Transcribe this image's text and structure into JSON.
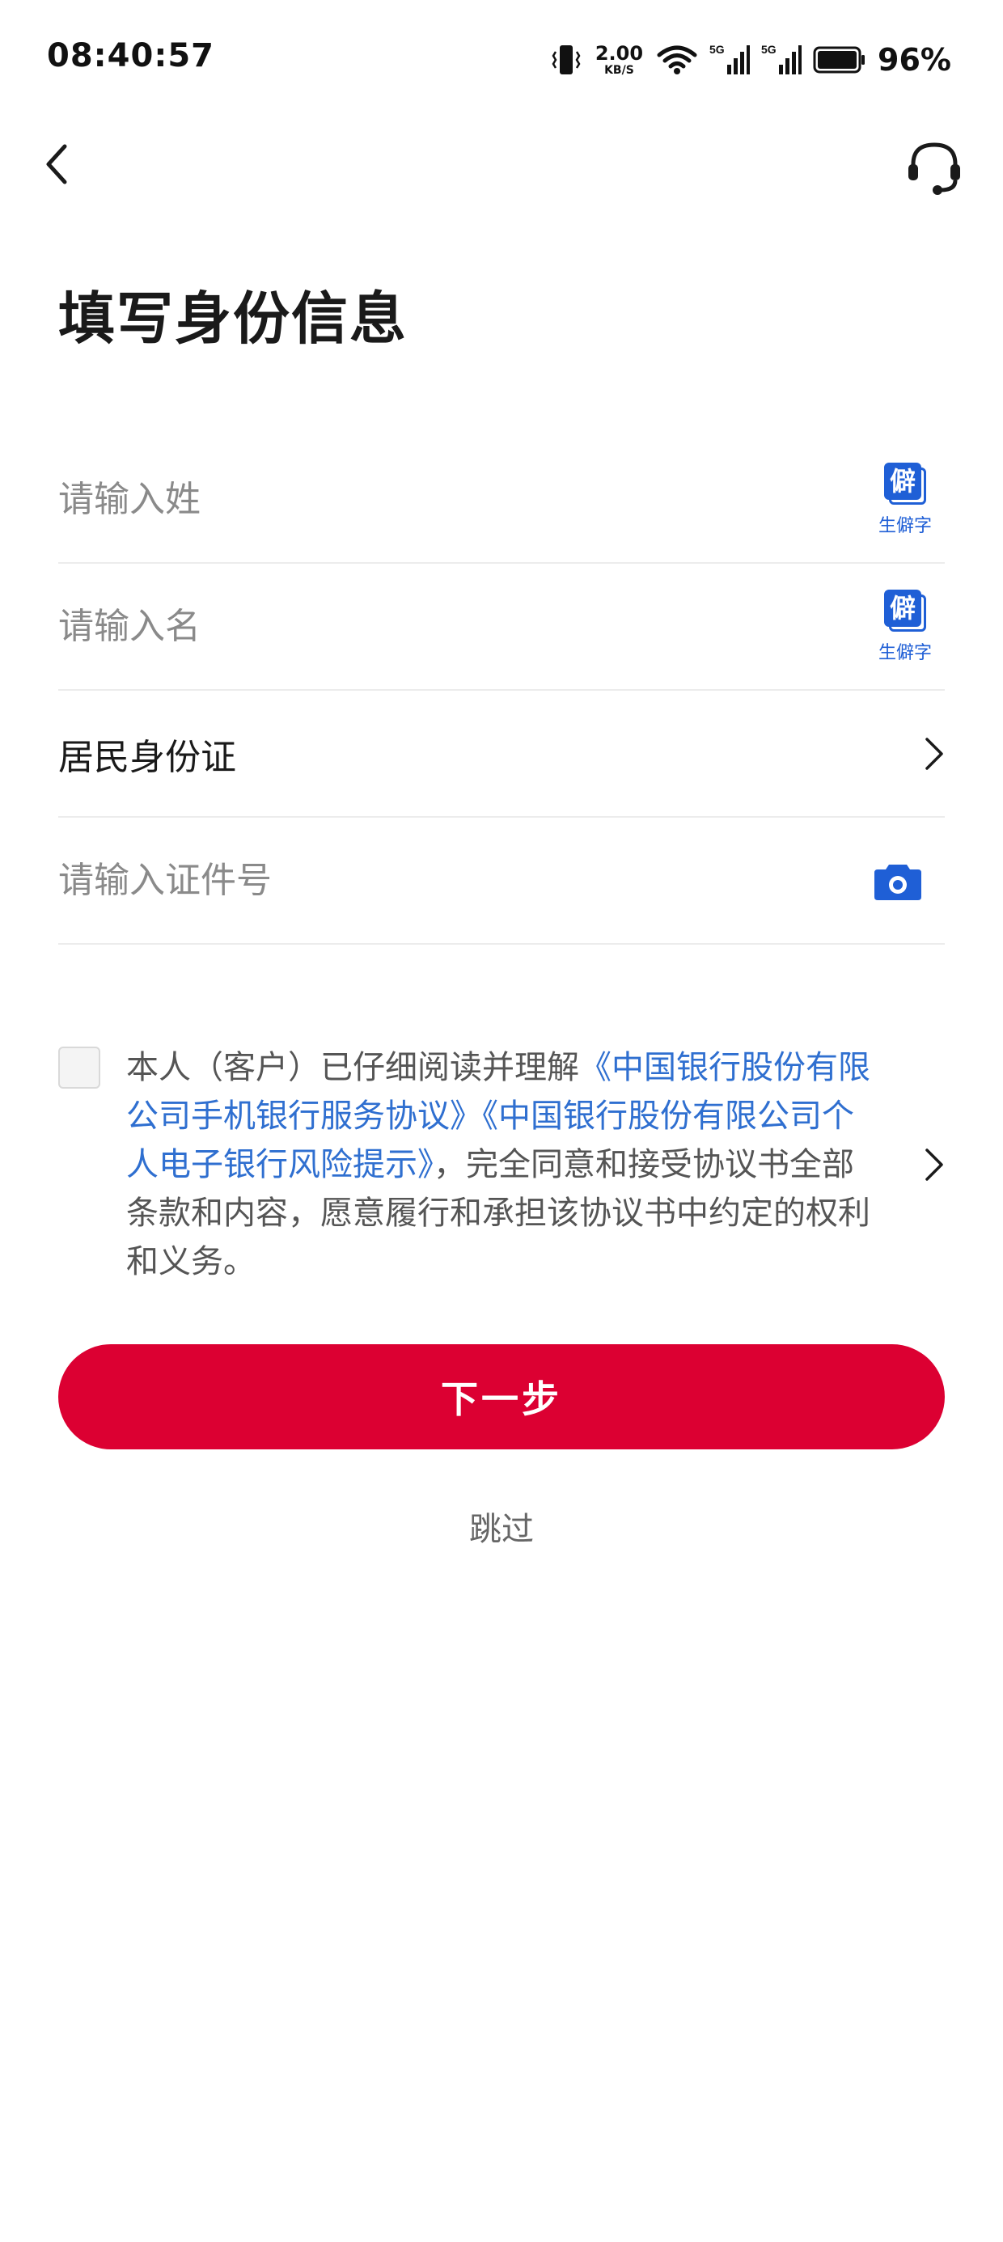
{
  "status_bar": {
    "time": "08:40:57",
    "net_speed_value": "2.00",
    "net_speed_unit": "KB/S",
    "signal_1_label": "5G",
    "signal_2_label": "5G",
    "battery_percent": "96%"
  },
  "nav": {
    "back_icon": "chevron-left-icon",
    "service_icon": "headset-icon"
  },
  "page": {
    "title": "填写身份信息"
  },
  "form": {
    "surname": {
      "placeholder": "请输入姓",
      "value": "",
      "rare_char_glyph": "僻",
      "rare_char_label": "生僻字"
    },
    "given_name": {
      "placeholder": "请输入名",
      "value": "",
      "rare_char_glyph": "僻",
      "rare_char_label": "生僻字"
    },
    "id_type": {
      "selected": "居民身份证"
    },
    "id_number": {
      "placeholder": "请输入证件号",
      "value": "",
      "icon": "camera-icon"
    }
  },
  "agreement": {
    "checked": false,
    "text_prefix": "本人（客户）已仔细阅读并理解",
    "link_1": "《中国银行股份有限公司手机银行服务协议》",
    "link_2": "《中国银行股份有限公司个人电子银行风险提示》",
    "text_suffix": "，完全同意和接受协议书全部条款和内容，愿意履行和承担该协议书中约定的权利和义务。"
  },
  "actions": {
    "next_label": "下一步",
    "skip_label": "跳过"
  },
  "colors": {
    "primary_red": "#dc0032",
    "link_blue": "#2f6fd0",
    "icon_blue": "#1f5fd6",
    "placeholder_gray": "#8a8a8a",
    "divider": "#ececec"
  }
}
